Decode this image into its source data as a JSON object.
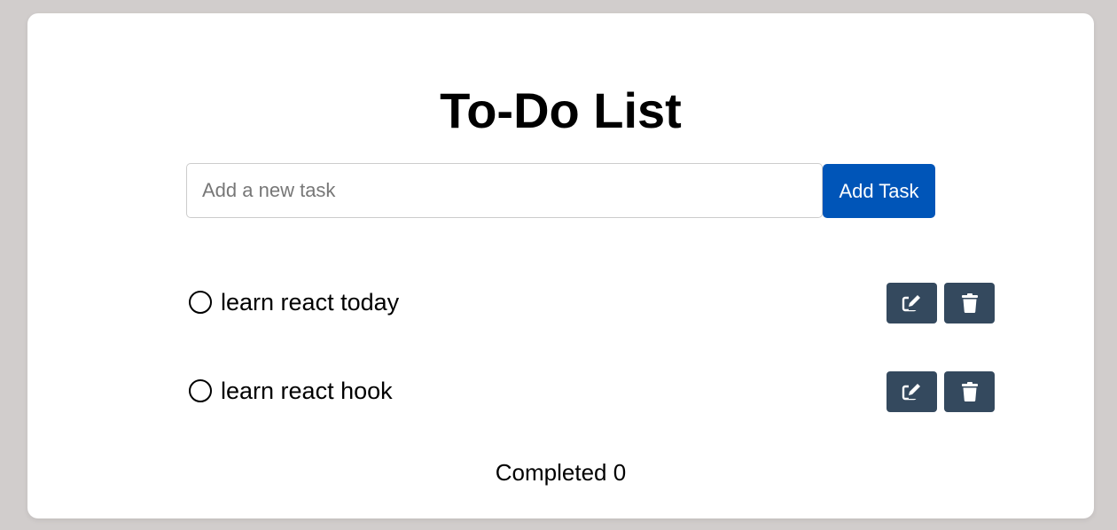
{
  "app": {
    "title": "To-Do List"
  },
  "new_task": {
    "value": "",
    "placeholder": "Add a new task",
    "add_label": "Add Task"
  },
  "tasks": [
    {
      "text": "learn react today",
      "completed": false
    },
    {
      "text": "learn react hook",
      "completed": false
    }
  ],
  "icons": {
    "check": "circle-outline-icon",
    "edit": "edit-icon",
    "delete": "trash-icon"
  },
  "summary": {
    "label": "Completed",
    "count": 0,
    "text": "Completed 0"
  },
  "colors": {
    "background": "#d1cdcc",
    "card": "#ffffff",
    "primary": "#0055b8",
    "action": "#34495e",
    "text": "#000000"
  }
}
